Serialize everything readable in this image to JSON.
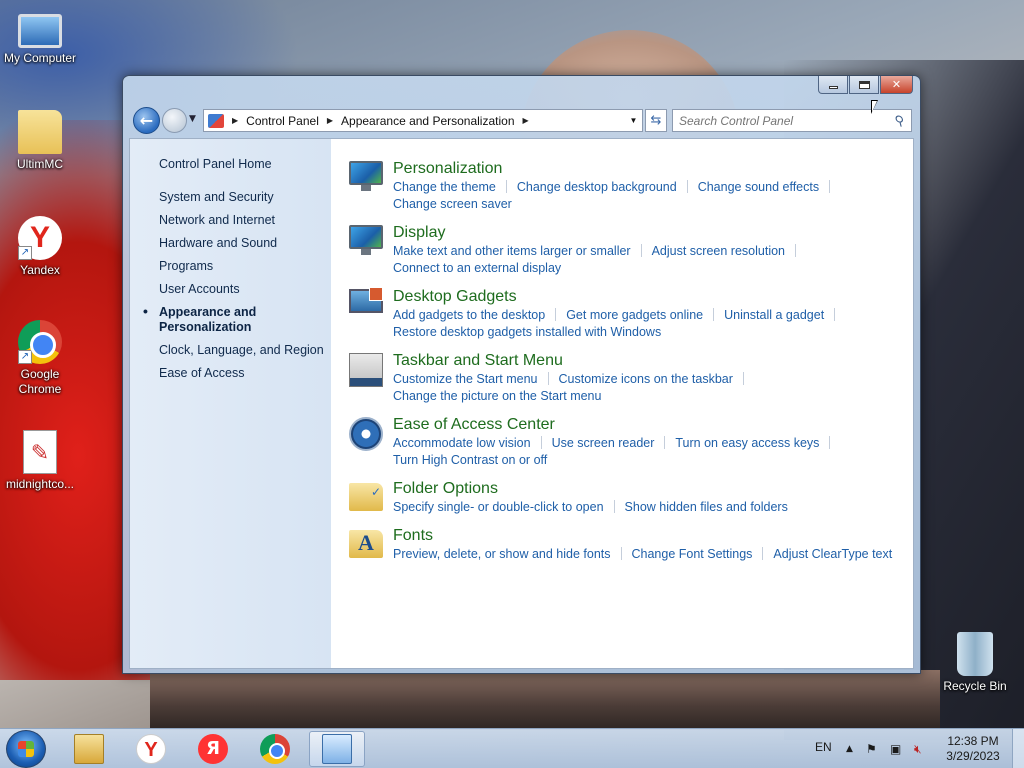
{
  "desktop": {
    "icons": [
      {
        "label": "My Computer",
        "icon": "computer-icon"
      },
      {
        "label": "UltimMC",
        "icon": "folder-icon"
      },
      {
        "label": "Yandex",
        "icon": "yandex-icon"
      },
      {
        "label": "Google Chrome",
        "icon": "chrome-icon"
      },
      {
        "label": "midnightco...",
        "icon": "file-icon"
      },
      {
        "label": "Recycle Bin",
        "icon": "recycle-bin-icon"
      }
    ]
  },
  "window": {
    "controls": {
      "minimize": "minimize",
      "maximize": "maximize",
      "close": "✕"
    },
    "address": {
      "crumbs": [
        "Control Panel",
        "Appearance and Personalization"
      ]
    },
    "search": {
      "placeholder": "Search Control Panel"
    },
    "sidebar": {
      "home": "Control Panel Home",
      "items": [
        "System and Security",
        "Network and Internet",
        "Hardware and Sound",
        "Programs",
        "User Accounts",
        "Appearance and Personalization",
        "Clock, Language, and Region",
        "Ease of Access"
      ],
      "current_index": 5
    },
    "categories": [
      {
        "title": "Personalization",
        "icon": "personalization-icon",
        "links": [
          "Change the theme",
          "Change desktop background",
          "Change sound effects",
          "Change screen saver"
        ]
      },
      {
        "title": "Display",
        "icon": "display-icon",
        "links": [
          "Make text and other items larger or smaller",
          "Adjust screen resolution",
          "Connect to an external display"
        ]
      },
      {
        "title": "Desktop Gadgets",
        "icon": "gadgets-icon",
        "links": [
          "Add gadgets to the desktop",
          "Get more gadgets online",
          "Uninstall a gadget",
          "Restore desktop gadgets installed with Windows"
        ]
      },
      {
        "title": "Taskbar and Start Menu",
        "icon": "taskbar-icon",
        "links": [
          "Customize the Start menu",
          "Customize icons on the taskbar",
          "Change the picture on the Start menu"
        ]
      },
      {
        "title": "Ease of Access Center",
        "icon": "ease-of-access-icon",
        "links": [
          "Accommodate low vision",
          "Use screen reader",
          "Turn on easy access keys",
          "Turn High Contrast on or off"
        ]
      },
      {
        "title": "Folder Options",
        "icon": "folder-options-icon",
        "links": [
          "Specify single- or double-click to open",
          "Show hidden files and folders"
        ]
      },
      {
        "title": "Fonts",
        "icon": "fonts-icon",
        "links": [
          "Preview, delete, or show and hide fonts",
          "Change Font Settings",
          "Adjust ClearType text"
        ]
      }
    ]
  },
  "taskbar": {
    "pinned": [
      "windows-explorer",
      "yandex-browser",
      "yandex",
      "google-chrome",
      "control-panel"
    ],
    "active": "control-panel",
    "language": "EN",
    "time": "12:38 PM",
    "date": "3/29/2023"
  },
  "colors": {
    "category_title": "#1e6c1e",
    "link": "#1f5fa8",
    "sidebar_text": "#102a4c"
  }
}
